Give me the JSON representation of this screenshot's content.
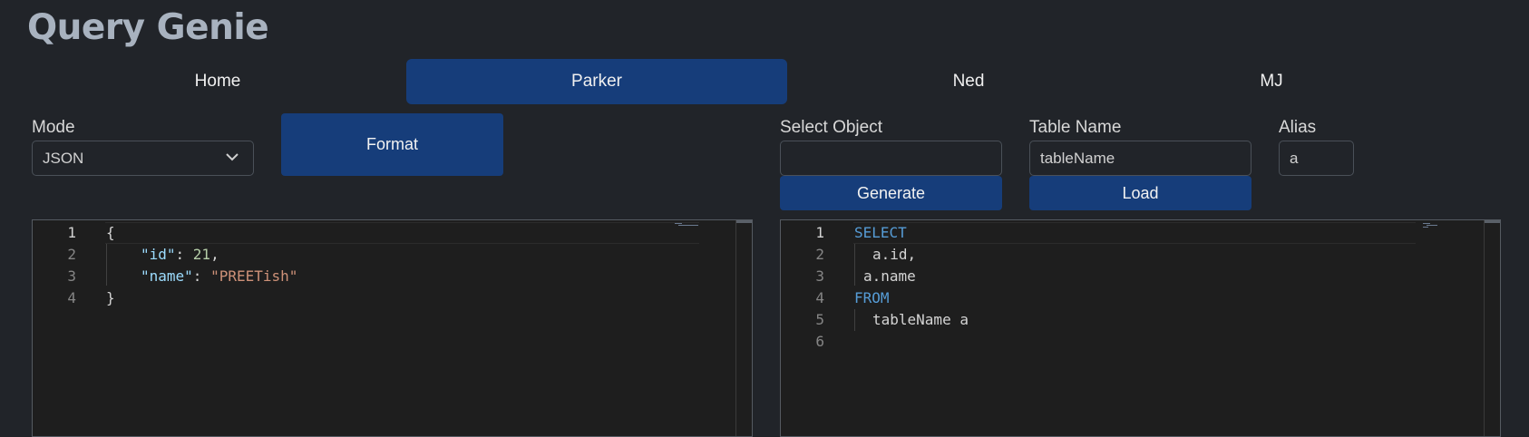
{
  "app": {
    "title": "Query Genie"
  },
  "nav": {
    "tabs": [
      {
        "label": "Home"
      },
      {
        "label": "Parker"
      },
      {
        "label": "Ned"
      },
      {
        "label": "MJ"
      }
    ],
    "active": "Parker"
  },
  "mode": {
    "label": "Mode",
    "value": "JSON"
  },
  "format_button": "Format",
  "select_object": {
    "label": "Select Object",
    "value": ""
  },
  "generate_button": "Generate",
  "table_name": {
    "label": "Table Name",
    "value": "tableName"
  },
  "load_button": "Load",
  "alias": {
    "label": "Alias",
    "value": "a"
  },
  "json_editor": {
    "line_numbers": [
      "1",
      "2",
      "3",
      "4"
    ],
    "tokens": {
      "l1_brace": "{",
      "l2_key": "\"id\"",
      "l2_colon": ": ",
      "l2_num": "21",
      "l2_comma": ",",
      "l3_key": "\"name\"",
      "l3_colon": ": ",
      "l3_str": "\"PREETish\"",
      "l4_brace": "}"
    }
  },
  "sql_editor": {
    "line_numbers": [
      "1",
      "2",
      "3",
      "4",
      "5",
      "6"
    ],
    "tokens": {
      "l1": "SELECT",
      "l2": "a.id,",
      "l3": "a.name",
      "l4": "FROM",
      "l5": "tableName a"
    }
  },
  "colors": {
    "background": "#212429",
    "accent": "#163d7a",
    "editor_bg": "#1e1e1e",
    "keyword": "#569cd6",
    "json_key": "#9cdcfe",
    "string": "#ce9178",
    "number": "#b5cea8"
  }
}
